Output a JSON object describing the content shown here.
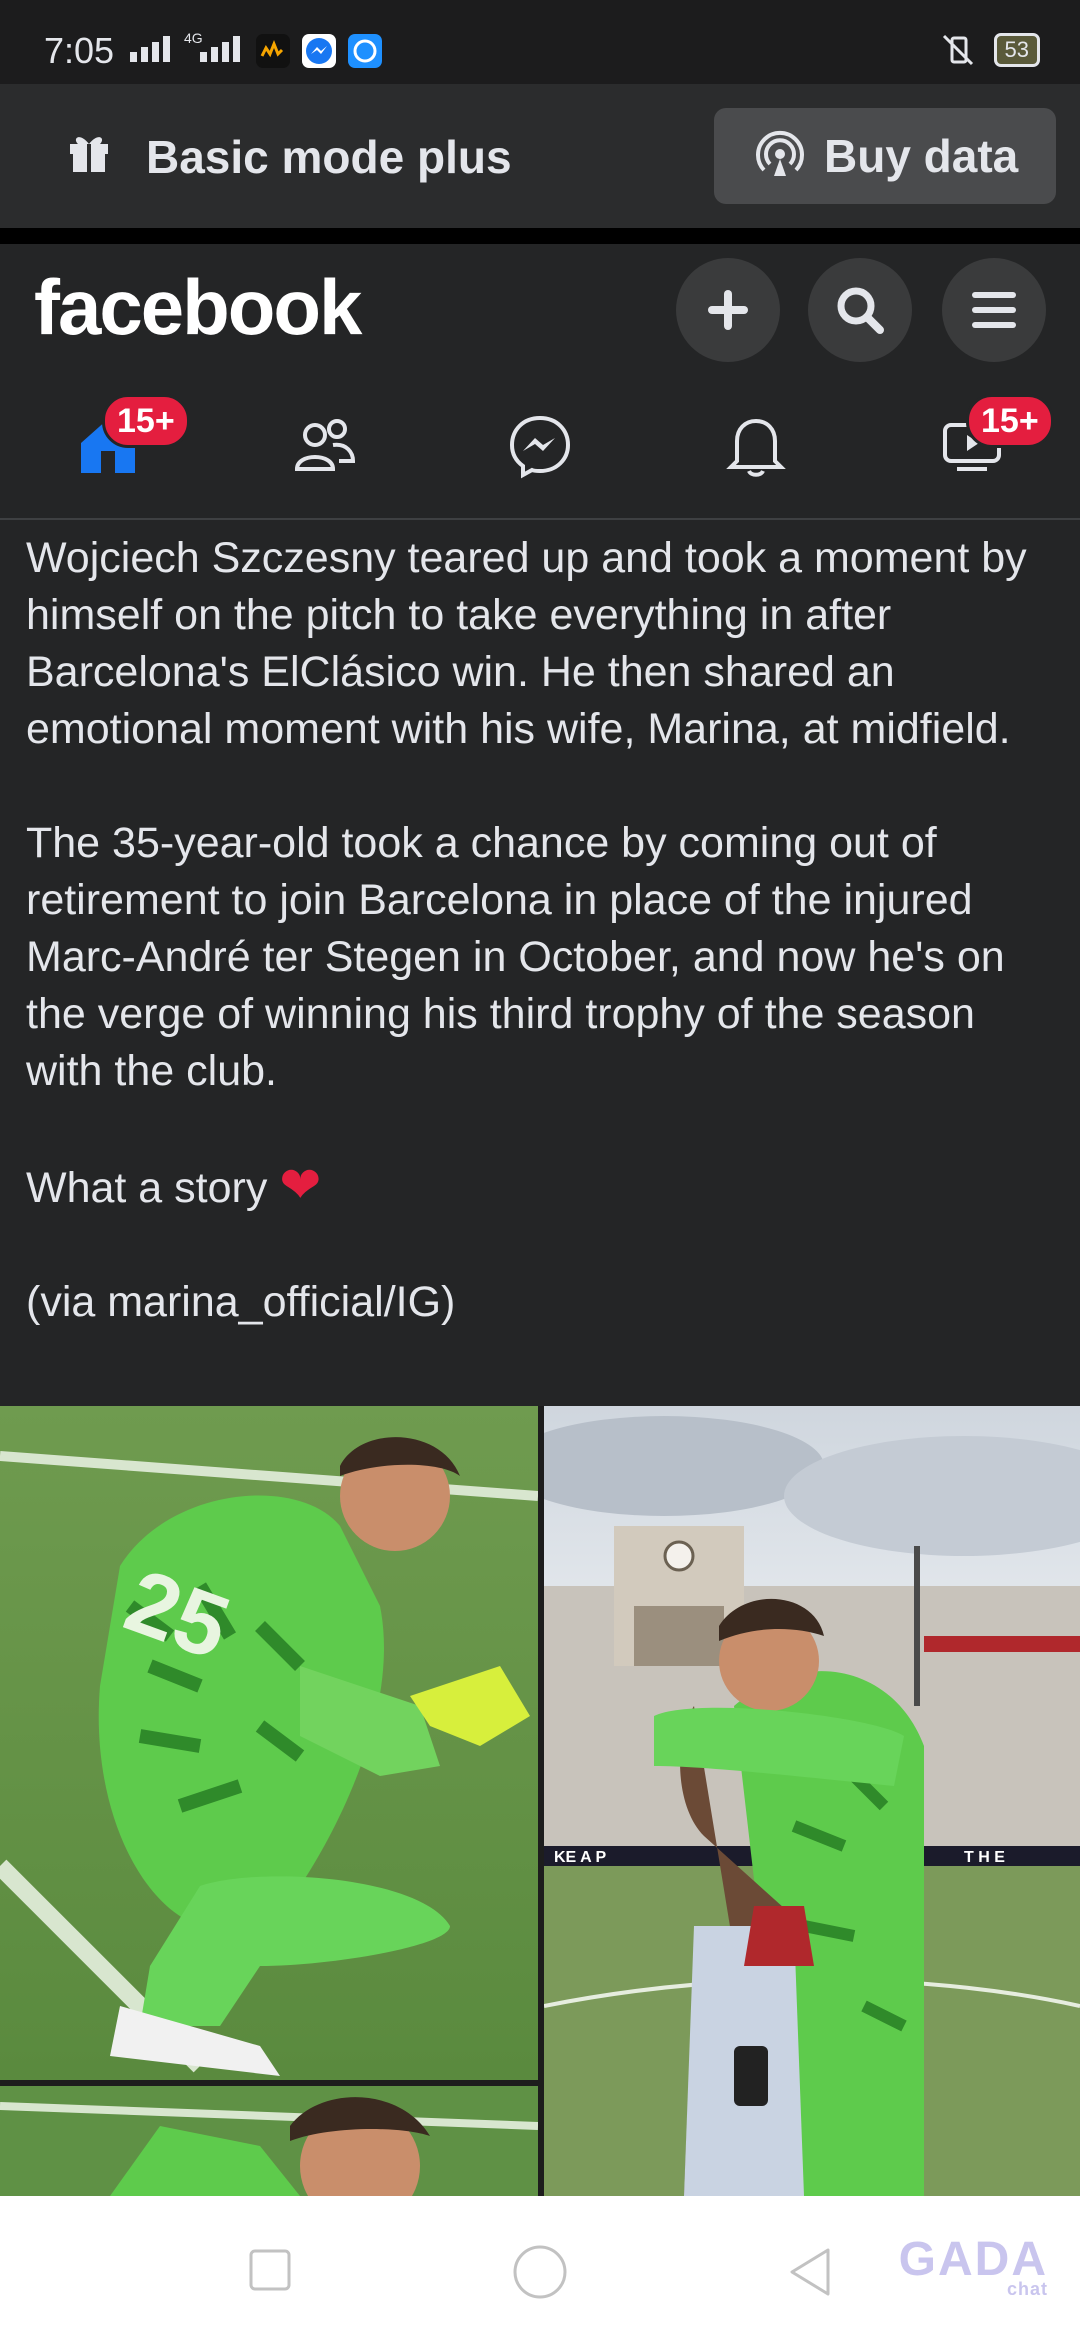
{
  "status_bar": {
    "time": "7:05",
    "network_label": "4G",
    "battery": "53"
  },
  "basic_mode": {
    "label": "Basic mode plus",
    "buy_button": "Buy data"
  },
  "header": {
    "logo": "facebook",
    "icons": [
      "plus-icon",
      "search-icon",
      "menu-icon"
    ]
  },
  "nav": {
    "items": [
      {
        "name": "home",
        "icon": "home-icon",
        "badge": "15+"
      },
      {
        "name": "friends",
        "icon": "friends-icon",
        "badge": ""
      },
      {
        "name": "messenger",
        "icon": "messenger-icon",
        "badge": ""
      },
      {
        "name": "notifications",
        "icon": "bell-icon",
        "badge": ""
      },
      {
        "name": "video",
        "icon": "video-icon",
        "badge": "15+"
      }
    ]
  },
  "post": {
    "paragraph_1": "Wojciech Szczesny teared up and took a moment by himself on the pitch to take everything in after Barcelona's ElClásico win. He then shared an emotional moment with his wife, Marina, at midfield.",
    "paragraph_2": "The 35-year-old took a chance by coming out of retirement to join Barcelona in place of the injured Marc-André ter Stegen in October, and now he's on the verge of winning his third trophy of the season with the club.",
    "paragraph_3": "What a story",
    "paragraph_4": "(via marina_official/IG)"
  },
  "photos": {
    "jersey_number": "25",
    "banner_left": "KE A P",
    "banner_right": "T H E"
  },
  "watermark": {
    "brand": "GADA",
    "sub": "chat"
  },
  "colors": {
    "background": "#242526",
    "badge": "#e41e3f",
    "text": "#e4e6eb",
    "accent_home": "#1877f2"
  }
}
